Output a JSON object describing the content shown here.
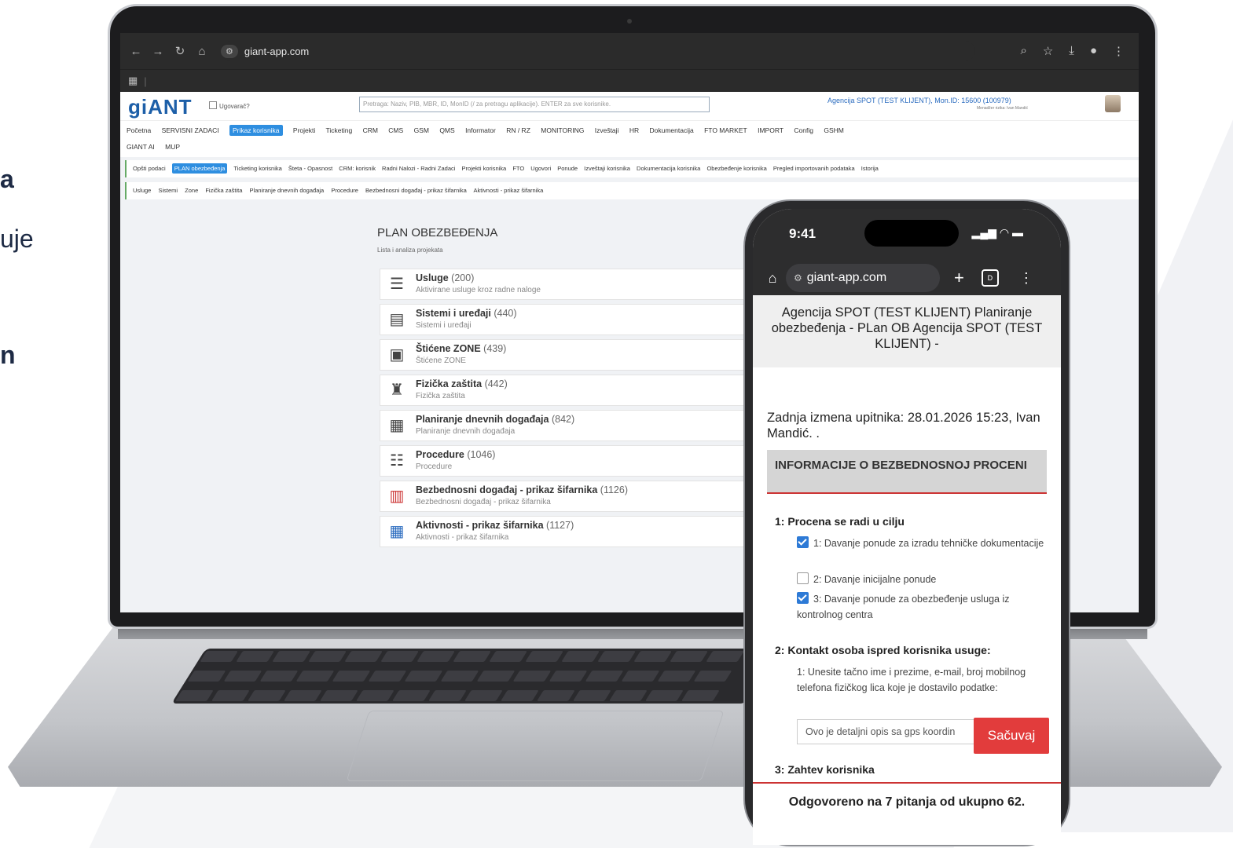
{
  "left_fragments": [
    "a",
    "uje",
    "n"
  ],
  "browser": {
    "url": "giant-app.com",
    "bookmarks_icon": "apps-grid-icon"
  },
  "app": {
    "logo": "giANT",
    "ugovarac_label": "Ugovarač?",
    "search_placeholder": "Pretraga: Naziv, PIB, MBR, ID, MonID (/ za pretragu aplikacije). ENTER za sve korisnike.",
    "agency": "Agencija SPOT (TEST KLIJENT), Mon.ID: 15600 (100979)",
    "agency_sub": "Menadžer rizika: Ivan Mandić",
    "menu": [
      "Početna",
      "SERVISNI ZADACI",
      "Prikaz korisnika",
      "Projekti",
      "Ticketing",
      "CRM",
      "CMS",
      "GSM",
      "QMS",
      "Informator",
      "RN / RZ",
      "MONITORING",
      "Izveštaji",
      "HR",
      "Dokumentacija",
      "FTO MARKET",
      "IMPORT",
      "Config",
      "GSHM",
      "GIANT AI",
      "MUP"
    ],
    "submenu": [
      "Opšti podaci",
      "PLAN obezbeđenja",
      "Ticketing korisnika",
      "Šteta - Opasnost",
      "CRM: korisnik",
      "Radni Nalozi - Radni Zadaci",
      "Projekti korisnika",
      "FTO",
      "Ugovori",
      "Ponude",
      "Izveštaji korisnika",
      "Dokumentacija korisnika",
      "Obezbeđenje korisnika",
      "Pregled importovanih podataka",
      "Istorija"
    ],
    "submenu2": [
      "Usluge",
      "Sistemi",
      "Zone",
      "Fizička zaštita",
      "Planiranje dnevnih događaja",
      "Procedure",
      "Bezbednosni događaj - prikaz šifarnika",
      "Aktivnosti - prikaz šifarnika"
    ],
    "plan_title": "PLAN OBEZBEĐENJA",
    "plan_subtitle": "Lista i analiza projekata",
    "items": [
      {
        "name": "Usluge",
        "count": "(200)",
        "desc": "Aktivirane usluge kroz radne naloge",
        "icon": "document-list-icon"
      },
      {
        "name": "Sistemi i uređaji",
        "count": "(440)",
        "desc": "Sistemi i uređaji",
        "icon": "server-rack-icon"
      },
      {
        "name": "Štićene ZONE",
        "count": "(439)",
        "desc": "Štićene ZONE",
        "icon": "zone-map-icon"
      },
      {
        "name": "Fizička zaštita",
        "count": "(442)",
        "desc": "Fizička zaštita",
        "icon": "guard-icon"
      },
      {
        "name": "Planiranje dnevnih događaja",
        "count": "(842)",
        "desc": "Planiranje dnevnih događaja",
        "icon": "planner-icon"
      },
      {
        "name": "Procedure",
        "count": "(1046)",
        "desc": "Procedure",
        "icon": "procedure-icon"
      },
      {
        "name": "Bezbednosni događaj - prikaz šifarnika",
        "count": "(1126)",
        "desc": "Bezbednosni događaj - prikaz šifarnika",
        "icon": "alert-calendar-icon"
      },
      {
        "name": "Aktivnosti - prikaz šifarnika",
        "count": "(1127)",
        "desc": "Aktivnosti - prikaz šifarnika",
        "icon": "calendar-grid-icon"
      }
    ]
  },
  "phone": {
    "time": "9:41",
    "url": "giant-app.com",
    "header": "Agencija SPOT (TEST KLIJENT) Planiranje obezbeđenja - PLan OB Agencija SPOT (TEST KLIJENT) -",
    "update": "Zadnja izmena upitnika: 28.01.2026 15:23, Ivan Mandić. .",
    "section": "INFORMACIJE O BEZBEDNOSNOJ PROCENI",
    "q1": "1: Procena se radi u cilju",
    "q1_opts": [
      {
        "text": "1: Davanje ponude za izradu tehničke dokumentacije",
        "checked": true
      },
      {
        "text": "2: Davanje inicijalne ponude",
        "checked": false
      },
      {
        "text": "3: Davanje ponude za obezbeđenje usluga iz kontrolnog centra",
        "checked": true
      }
    ],
    "q2": "2: Kontakt osoba ispred korisnika usuge:",
    "q2_text": "1: Unesite tačno ime i prezime, e-mail, broj mobilnog telefona fizičkog lica koje je dostavilo podatke:",
    "input_value": "Ovo je detaljni opis sa gps koordin",
    "save_label": "Sačuvaj",
    "q3": "3: Zahtev korisnika",
    "footer": "Odgovoreno na 7 pitanja od ukupno 62.",
    "accent": "#e23c3c"
  }
}
